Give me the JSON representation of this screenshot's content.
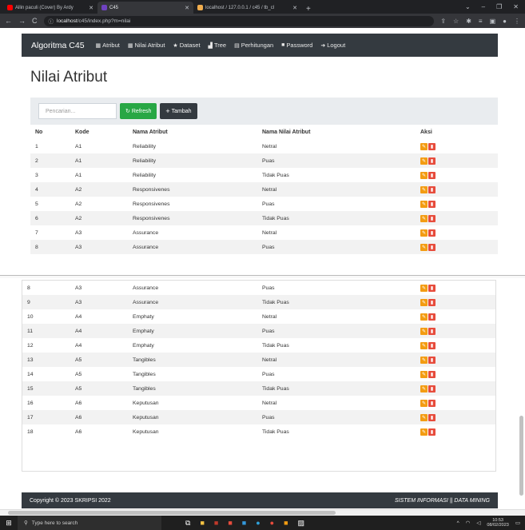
{
  "browser": {
    "tabs": [
      {
        "label": "Allin paculi (Cover) By Ardy",
        "favicon_color": "#ff0000",
        "active": false
      },
      {
        "label": "C45",
        "favicon_color": "#6f42c1",
        "active": true
      },
      {
        "label": "localhost / 127.0.0.1 / c45 / tb_cl",
        "favicon_color": "#f0ad4e",
        "active": false
      }
    ],
    "url_host": "localhost",
    "url_path": "/c45/index.php?m=nilai"
  },
  "navbar": {
    "brand": "Algoritma C45",
    "items": [
      {
        "label": "Atribut",
        "icon": "table-icon"
      },
      {
        "label": "Nilai Atribut",
        "icon": "grid-icon"
      },
      {
        "label": "Dataset",
        "icon": "star-icon"
      },
      {
        "label": "Tree",
        "icon": "bar-chart-icon"
      },
      {
        "label": "Perhitungan",
        "icon": "calculator-icon"
      },
      {
        "label": "Password",
        "icon": "lock-icon"
      },
      {
        "label": "Logout",
        "icon": "logout-icon"
      }
    ]
  },
  "page": {
    "title": "Nilai Atribut",
    "search_placeholder": "Pencarian...",
    "refresh_label": "Refresh",
    "tambah_label": "Tambah"
  },
  "table": {
    "headers": [
      "No",
      "Kode",
      "Nama Atribut",
      "Nama Nilai Atribut",
      "Aksi"
    ],
    "rows": [
      [
        "1",
        "A1",
        "Reliability",
        "Netral"
      ],
      [
        "2",
        "A1",
        "Reliability",
        "Puas"
      ],
      [
        "3",
        "A1",
        "Reliability",
        "Tidak Puas"
      ],
      [
        "4",
        "A2",
        "Responsivenes",
        "Netral"
      ],
      [
        "5",
        "A2",
        "Responsivenes",
        "Puas"
      ],
      [
        "6",
        "A2",
        "Responsivenes",
        "Tidak Puas"
      ],
      [
        "7",
        "A3",
        "Assurance",
        "Netral"
      ],
      [
        "8",
        "A3",
        "Assurance",
        "Puas"
      ]
    ],
    "rows_lower": [
      [
        "8",
        "A3",
        "Assurance",
        "Puas"
      ],
      [
        "9",
        "A3",
        "Assurance",
        "Tidak Puas"
      ],
      [
        "10",
        "A4",
        "Emphaty",
        "Netral"
      ],
      [
        "11",
        "A4",
        "Emphaty",
        "Puas"
      ],
      [
        "12",
        "A4",
        "Emphaty",
        "Tidak Puas"
      ],
      [
        "13",
        "A5",
        "Tangibles",
        "Netral"
      ],
      [
        "14",
        "A5",
        "Tangibles",
        "Puas"
      ],
      [
        "15",
        "A5",
        "Tangibles",
        "Tidak Puas"
      ],
      [
        "16",
        "A6",
        "Keputusan",
        "Netral"
      ],
      [
        "17",
        "A6",
        "Keputusan",
        "Puas"
      ],
      [
        "18",
        "A6",
        "Keputusan",
        "Tidak Puas"
      ]
    ]
  },
  "footer": {
    "left": "Copyright © 2023 SKRIPSI 2022",
    "right": "SISTEM INFORMASI || DATA MINING"
  },
  "taskbar": {
    "search_placeholder": "Type here to search",
    "time": "10:53",
    "date": "08/02/2023"
  },
  "colors": {
    "navbar": "#343a40",
    "refresh": "#28a745",
    "edit": "#f39c12",
    "delete": "#e74c3c"
  }
}
